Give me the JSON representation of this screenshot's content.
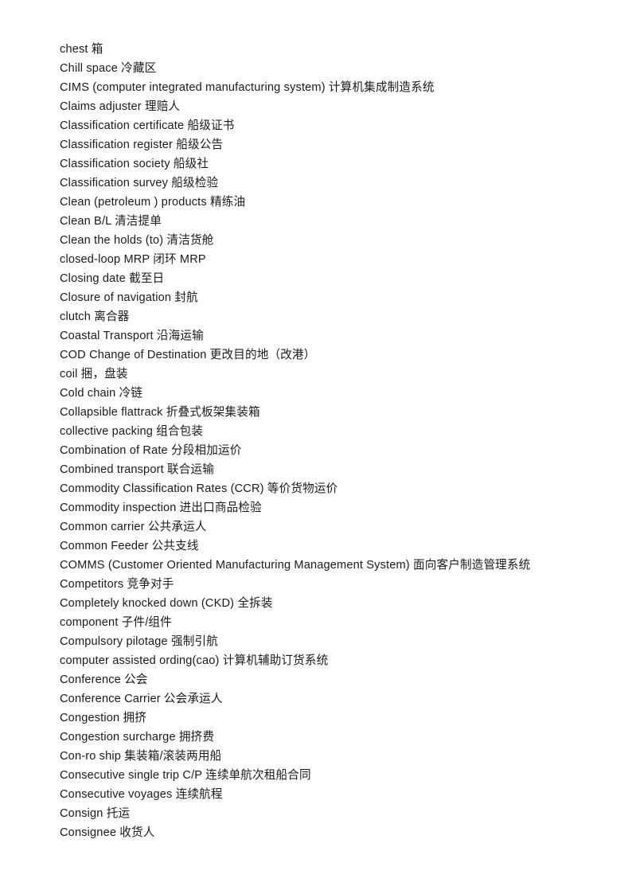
{
  "document": {
    "type": "glossary-page",
    "language": "en-zh",
    "background_color": "#ffffff",
    "text_color": "#1a1a1a",
    "entries": [
      "chest  箱",
      "Chill space 冷藏区",
      "CIMS (computer integrated manufacturing system) 计算机集成制造系统",
      "Claims adjuster  理赔人",
      "Classification certificate  船级证书",
      "Classification register  船级公告",
      "Classification society  船级社",
      "Classification survey  船级检验",
      "Clean (petroleum ) products  精练油",
      "Clean B/L  清洁提单",
      "Clean the holds (to)  清洁货舱",
      "closed-loop MRP  闭环 MRP",
      "Closing date  截至日",
      "Closure of navigation  封航",
      "clutch 离合器",
      "Coastal Transport  沿海运输",
      "COD Change of Destination  更改目的地（改港）",
      "coil  捆，盘装",
      "Cold chain 冷链",
      "Collapsible flattrack  折叠式板架集装箱",
      "collective packing  组合包装",
      "Combination of Rate  分段相加运价",
      "Combined transport 联合运输",
      "Commodity Classification Rates (CCR) 等价货物运价",
      "Commodity inspection 进出口商品检验",
      "Common carrier  公共承运人",
      "Common Feeder  公共支线",
      "COMMS (Customer Oriented Manufacturing Management System) 面向客户制造管理系统",
      "Competitors  竞争对手",
      "Completely knocked down (CKD)  全拆装",
      "component  子件/组件",
      "Compulsory pilotage  强制引航",
      "computer assisted ording(cao) 计算机辅助订货系统",
      "Conference  公会",
      "Conference Carrier  公会承运人",
      "Congestion  拥挤",
      "Congestion surcharge  拥挤费",
      "Con-ro ship  集装箱/滚装两用船",
      "Consecutive single trip C/P  连续单航次租船合同",
      "Consecutive voyages  连续航程",
      "Consign  托运",
      "Consignee  收货人"
    ]
  }
}
